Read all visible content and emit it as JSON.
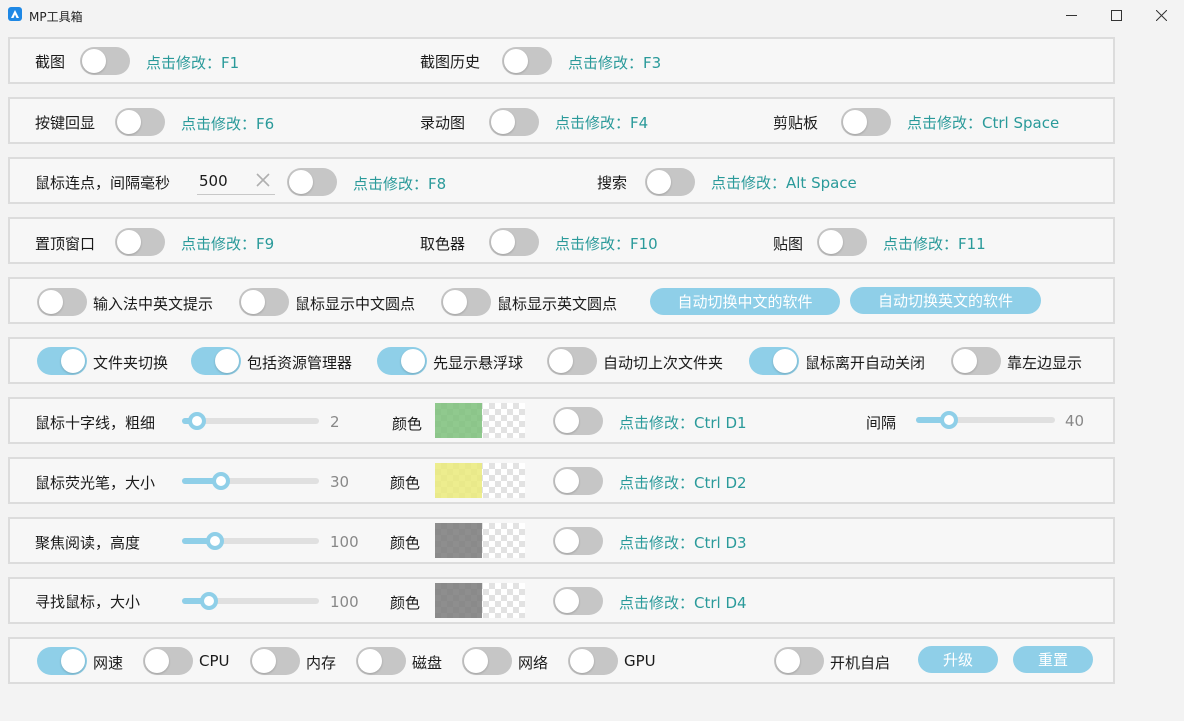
{
  "window": {
    "title": "MP工具箱"
  },
  "row1": {
    "screenshot_label": "截图",
    "screenshot_hotkey": "点击修改：F1",
    "history_label": "截图历史",
    "history_hotkey": "点击修改：F3"
  },
  "row2": {
    "keyecho_label": "按键回显",
    "keyecho_hotkey": "点击修改：F6",
    "record_label": "录动图",
    "record_hotkey": "点击修改：F4",
    "clipboard_label": "剪贴板",
    "clipboard_hotkey": "点击修改：Ctrl Space"
  },
  "row3": {
    "autoclick_label": "鼠标连点，间隔毫秒",
    "interval_value": "500",
    "autoclick_hotkey": "点击修改：F8",
    "search_label": "搜索",
    "search_hotkey": "点击修改：Alt Space"
  },
  "row4": {
    "pin_label": "置顶窗口",
    "pin_hotkey": "点击修改：F9",
    "picker_label": "取色器",
    "picker_hotkey": "点击修改：F10",
    "paste_label": "贴图",
    "paste_hotkey": "点击修改：F11"
  },
  "row5": {
    "ime_label": "输入法中英文提示",
    "cn_dot_label": "鼠标显示中文圆点",
    "en_dot_label": "鼠标显示英文圆点",
    "auto_cn_button": "自动切换中文的软件",
    "auto_en_button": "自动切换英文的软件"
  },
  "row6": {
    "folder_label": "文件夹切换",
    "explorer_label": "包括资源管理器",
    "ball_label": "先显示悬浮球",
    "lastfolder_label": "自动切上次文件夹",
    "autoclose_label": "鼠标离开自动关闭",
    "left_label": "靠左边显示"
  },
  "row7": {
    "crosshair_label": "鼠标十字线，粗细",
    "thickness_value": "2",
    "thickness_level": 0.05,
    "color_label": "颜色",
    "color": "#7dc07a",
    "hotkey": "点击修改：Ctrl D1",
    "gap_label": "间隔",
    "gap_value": "40",
    "gap_level": 0.2
  },
  "row8": {
    "highlighter_label": "鼠标荧光笔，大小",
    "size_value": "30",
    "size_level": 0.25,
    "color_label": "颜色",
    "color": "#eaea7a",
    "hotkey": "点击修改：Ctrl D2"
  },
  "row9": {
    "focus_label": "聚焦阅读，高度",
    "height_value": "100",
    "height_level": 0.2,
    "color_label": "颜色",
    "color": "#7a7a7a",
    "hotkey": "点击修改：Ctrl D3"
  },
  "row10": {
    "find_label": "寻找鼠标，大小",
    "size_value": "100",
    "size_level": 0.15,
    "color_label": "颜色",
    "color": "#7a7a7a",
    "hotkey": "点击修改：Ctrl D4"
  },
  "row11": {
    "net_speed_label": "网速",
    "cpu_label": "CPU",
    "memory_label": "内存",
    "disk_label": "磁盘",
    "network_label": "网络",
    "gpu_label": "GPU",
    "autostart_label": "开机自启",
    "upgrade_button": "升级",
    "reset_button": "重置"
  },
  "colors": {
    "accent": "#8fcfe8",
    "hotkey_text": "#2a9a9a",
    "toggle_off": "#c6c6c6"
  },
  "toggles": {
    "screenshot": false,
    "history": false,
    "keyecho": false,
    "record": false,
    "clipboard": false,
    "autoclick": false,
    "search": false,
    "pin": false,
    "picker": false,
    "paste": false,
    "ime": false,
    "cn_dot": false,
    "en_dot": false,
    "folder": true,
    "explorer": true,
    "ball": true,
    "lastfolder": false,
    "autoclose": true,
    "left": false,
    "crosshair": false,
    "highlighter": false,
    "focus": false,
    "find": false,
    "net_speed": true,
    "cpu": false,
    "memory": false,
    "disk": false,
    "network": false,
    "gpu": false,
    "autostart": false
  }
}
